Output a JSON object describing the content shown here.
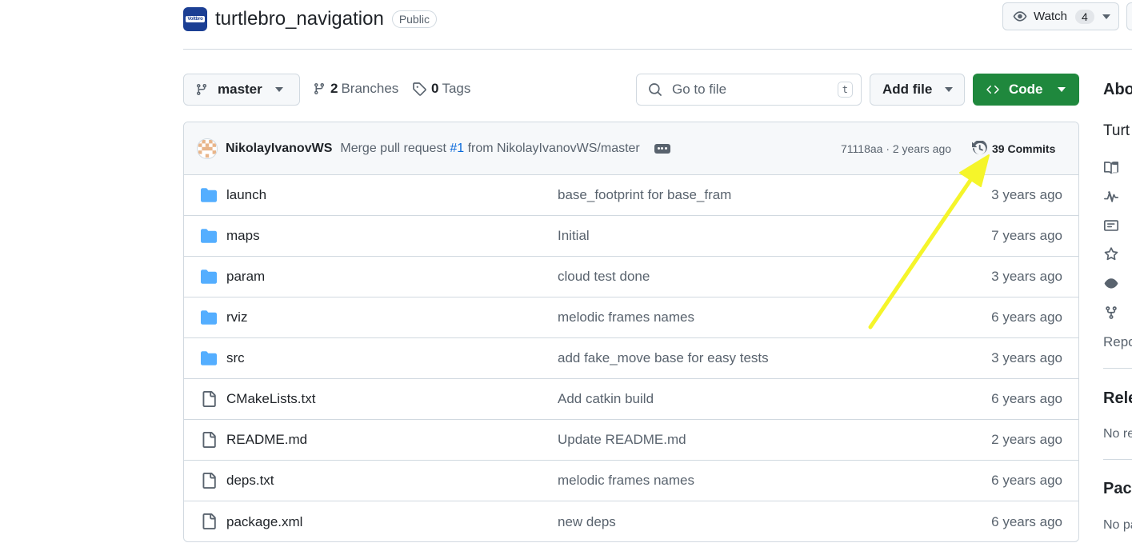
{
  "repo": {
    "logo_text": "Voltbro",
    "name": "turtlebro_navigation",
    "visibility": "Public"
  },
  "watch": {
    "label": "Watch",
    "count": "4"
  },
  "toolbar": {
    "branch": "master",
    "branches_count": "2",
    "branches_label": "Branches",
    "tags_count": "0",
    "tags_label": "Tags",
    "goto_placeholder": "Go to file",
    "goto_shortcut": "t",
    "add_file": "Add file",
    "code": "Code"
  },
  "latest_commit": {
    "author": "NikolayIvanovWS",
    "message_prefix": "Merge pull request",
    "pr": "#1",
    "message_suffix": "from NikolayIvanovWS/master",
    "sha_time": "71118aa · 2 years ago",
    "commits_label": "39 Commits"
  },
  "files": [
    {
      "type": "dir",
      "name": "launch",
      "message": "base_footprint for base_fram",
      "age": "3 years ago"
    },
    {
      "type": "dir",
      "name": "maps",
      "message": "Initial",
      "age": "7 years ago"
    },
    {
      "type": "dir",
      "name": "param",
      "message": "cloud test done",
      "age": "3 years ago"
    },
    {
      "type": "dir",
      "name": "rviz",
      "message": "melodic frames names",
      "age": "6 years ago"
    },
    {
      "type": "dir",
      "name": "src",
      "message": "add fake_move base for easy tests",
      "age": "3 years ago"
    },
    {
      "type": "file",
      "name": "CMakeLists.txt",
      "message": "Add catkin build",
      "age": "6 years ago"
    },
    {
      "type": "file",
      "name": "README.md",
      "message": "Update README.md",
      "age": "2 years ago"
    },
    {
      "type": "file",
      "name": "deps.txt",
      "message": "melodic frames names",
      "age": "6 years ago"
    },
    {
      "type": "file",
      "name": "package.xml",
      "message": "new deps",
      "age": "6 years ago"
    }
  ],
  "sidebar": {
    "about": "Abo",
    "desc": "Turt",
    "repo_link": "Repo",
    "releases": "Rele",
    "releases_empty": "No re",
    "packages": "Pack",
    "packages_empty": "No pa",
    "icons": [
      "book-icon",
      "pulse-icon",
      "law-icon",
      "star-icon",
      "eye-icon",
      "fork-icon"
    ]
  },
  "colors": {
    "accent_green": "#1f883d",
    "link_blue": "#0969da",
    "folder_blue": "#54aeff",
    "annotation_arrow": "#f5f52a"
  }
}
